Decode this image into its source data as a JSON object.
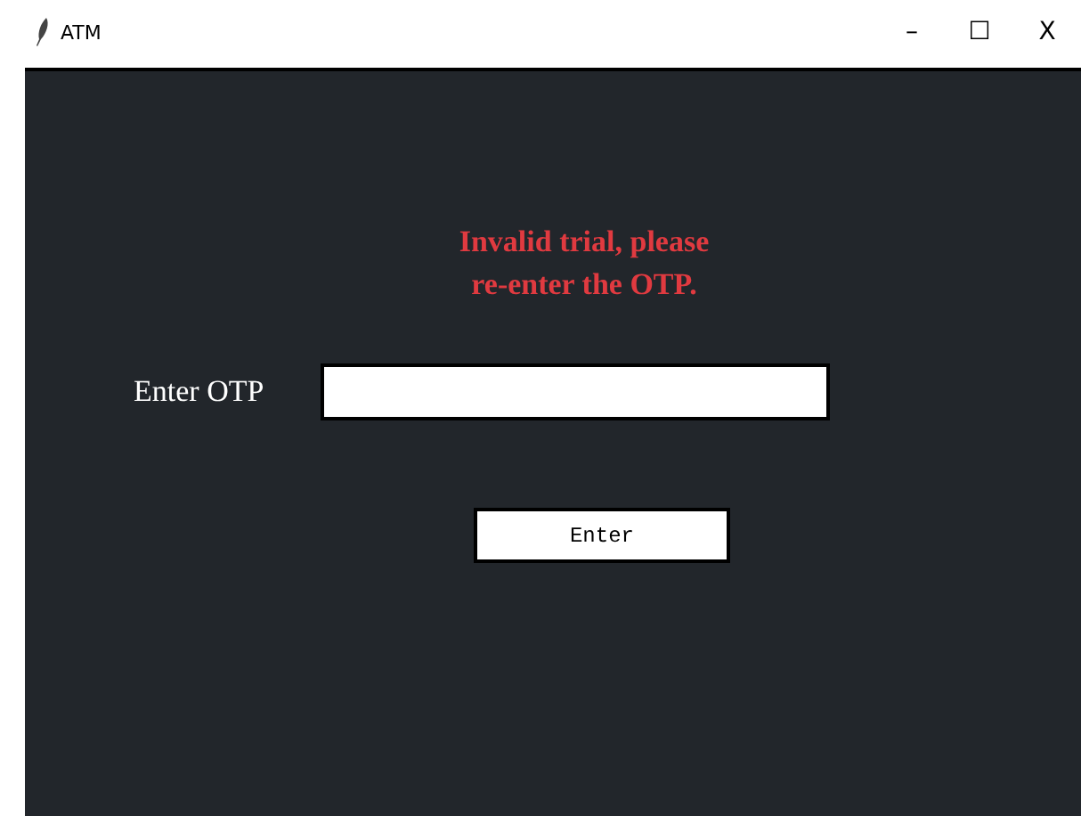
{
  "window": {
    "title": "ATM",
    "controls": [
      "–",
      "☐",
      "X"
    ]
  },
  "message": "Invalid trial, please\n re-enter the OTP.",
  "otp_field": {
    "label": "Enter OTP"
  },
  "enter_button": "Enter"
}
